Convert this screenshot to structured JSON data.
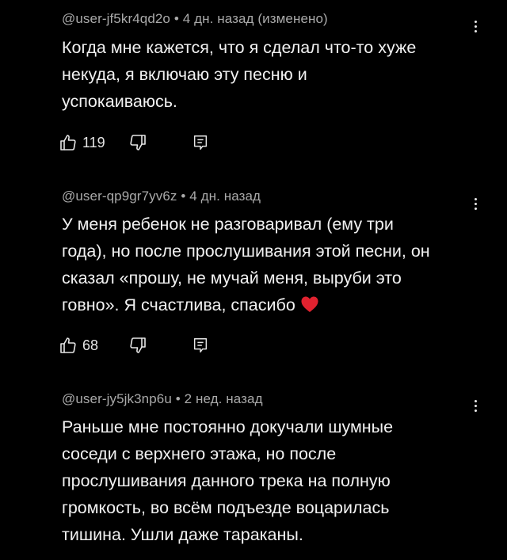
{
  "comments": [
    {
      "author": "@user-jf5kr4qd2o",
      "time": "4 дн. назад (изменено)",
      "lines": [
        "Когда мне кажется, что я сделал что-то хуже",
        "некуда, я включаю эту песню и",
        "успокаиваюсь."
      ],
      "likes": "119",
      "has_actions": true
    },
    {
      "author": "@user-qp9gr7yv6z",
      "time": "4 дн. назад",
      "lines": [
        "У меня ребенок не разговаривал (ему три",
        "года), но после прослушивания этой песни, он",
        "сказал «прошу, не мучай меня, выруби это",
        "говно». Я счастлива, спасибо"
      ],
      "trailing_emoji": "red-heart-emoji",
      "likes": "68",
      "has_actions": true
    },
    {
      "author": "@user-jy5jk3np6u",
      "time": "2 нед. назад",
      "lines": [
        "Раньше мне постоянно докучали шумные",
        "соседи с верхнего этажа, но после",
        "прослушивания данного трека на полную",
        "громкость, во всём подъезде воцарилась",
        "тишина. Ушли даже тараканы."
      ],
      "has_actions": false
    }
  ],
  "separator": "•",
  "icons": {
    "like": "thumbs-up-icon",
    "dislike": "thumbs-down-icon",
    "reply": "reply-icon",
    "menu": "more-vertical-icon"
  },
  "colors": {
    "background": "#000000",
    "text": "#f1f1f1",
    "meta": "#aaaaaa",
    "heart": "#e0222f"
  }
}
